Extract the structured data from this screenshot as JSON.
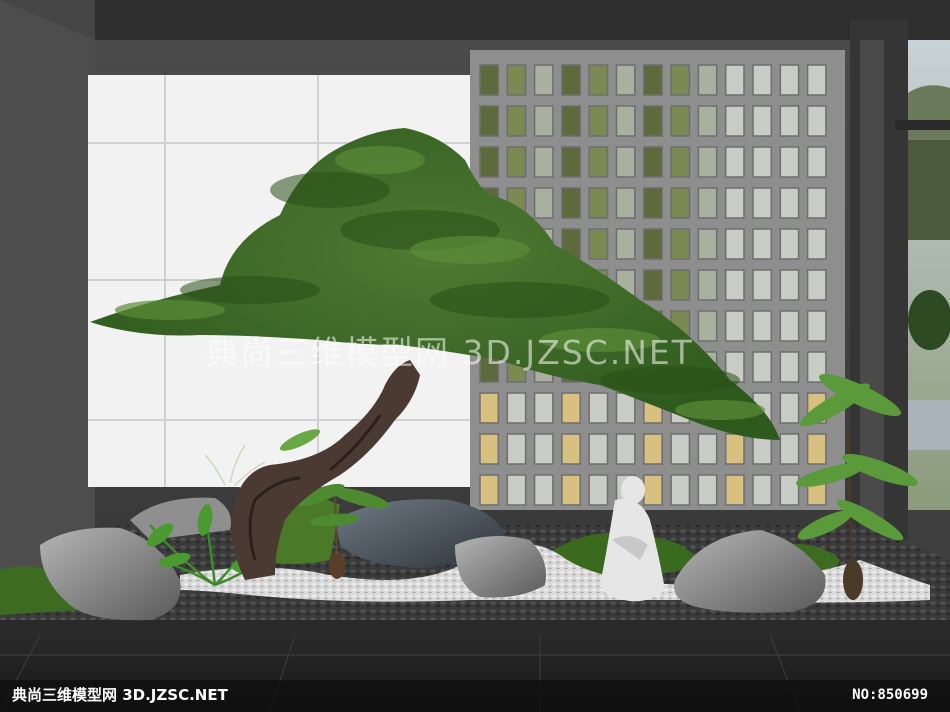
{
  "watermark": {
    "center": "典尚三维模型网 3D.JZSC.NET",
    "bottom_left": "典尚三维模型网 3D.JZSC.NET",
    "bottom_right": "NO:850699"
  }
}
